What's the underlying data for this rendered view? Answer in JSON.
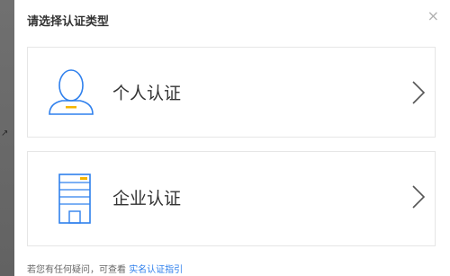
{
  "dialog": {
    "title": "请选择认证类型",
    "close_symbol": "×"
  },
  "options": [
    {
      "label": "个人认证",
      "icon": "person-icon"
    },
    {
      "label": "企业认证",
      "icon": "building-icon"
    }
  ],
  "footer": {
    "text": "若您有任何疑问，可查看",
    "link_text": "实名认证指引"
  },
  "colors": {
    "accent_blue": "#2f80ed",
    "icon_yellow": "#f5b400"
  }
}
